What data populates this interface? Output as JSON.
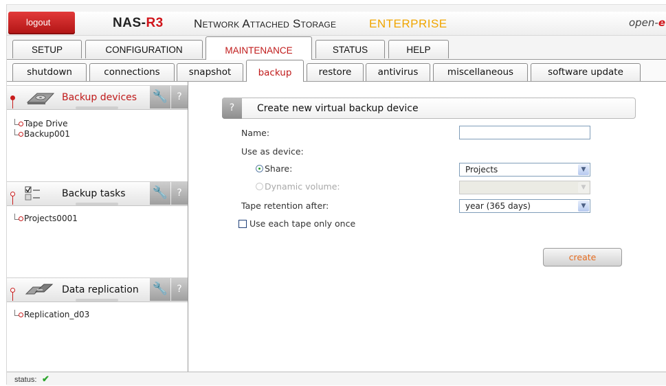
{
  "header": {
    "logout_label": "logout",
    "brand_name": "NAS-",
    "brand_suffix": "R3",
    "subtitle": "Network Attached Storage",
    "edition": "ENTERPRISE",
    "logo_text": "open-",
    "logo_e": "e"
  },
  "main_tabs": [
    {
      "label": "SETUP"
    },
    {
      "label": "CONFIGURATION"
    },
    {
      "label": "MAINTENANCE",
      "active": true
    },
    {
      "label": "STATUS"
    },
    {
      "label": "HELP"
    }
  ],
  "sub_tabs": [
    {
      "label": "shutdown"
    },
    {
      "label": "connections"
    },
    {
      "label": "snapshot"
    },
    {
      "label": "backup",
      "active": true
    },
    {
      "label": "restore"
    },
    {
      "label": "antivirus"
    },
    {
      "label": "miscellaneous"
    },
    {
      "label": "software update"
    }
  ],
  "sidebar": {
    "wrench_glyph": "🔧",
    "help_glyph": "?",
    "groups": [
      {
        "title": "Backup devices",
        "icon": "backup-drive-icon",
        "items": [
          "Tape Drive",
          "Backup001"
        ]
      },
      {
        "title": "Backup tasks",
        "icon": "task-list-icon",
        "items": [
          "Projects0001"
        ]
      },
      {
        "title": "Data replication",
        "icon": "replication-icon",
        "items": [
          "Replication_d03"
        ]
      }
    ]
  },
  "form": {
    "help_glyph": "?",
    "title": "Create new virtual backup device",
    "name_label": "Name:",
    "name_value": "",
    "use_as_device_label": "Use as device:",
    "share_label": "Share:",
    "share_selected": "Projects",
    "dynamic_volume_label": "Dynamic volume:",
    "dynamic_volume_selected": "",
    "tape_retention_label": "Tape retention after:",
    "tape_retention_selected": "year (365 days)",
    "use_once_label": "Use each tape only once",
    "create_label": "create"
  },
  "status": {
    "label": "status:",
    "icon": "checkmark-icon",
    "glyph": "✔"
  },
  "colors": {
    "accent_red": "#c01a1a",
    "edition_orange": "#f0a500",
    "button_text": "#e46b1f",
    "ok_green": "#2da52d"
  }
}
